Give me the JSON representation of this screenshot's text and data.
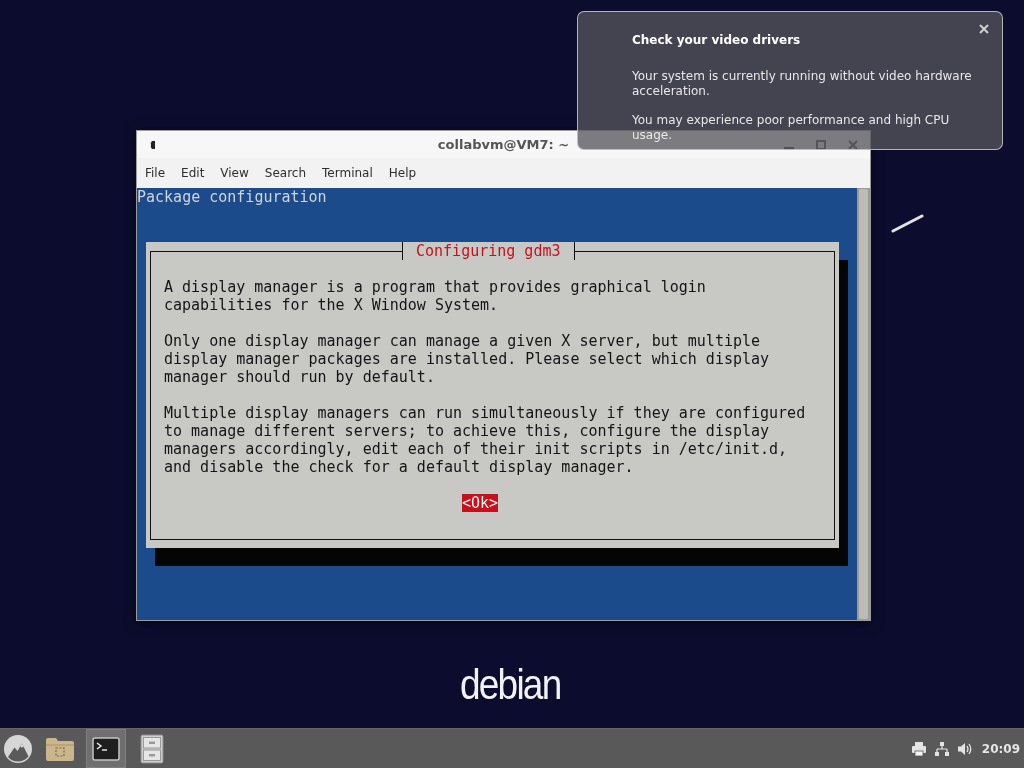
{
  "notification": {
    "title": "Check your video drivers",
    "paragraphs": [
      "Your system is currently running without video hardware acceleration.",
      "You may experience poor performance and high CPU usage."
    ]
  },
  "terminal_window": {
    "title": "collabvm@VM7: ~",
    "menu": [
      "File",
      "Edit",
      "View",
      "Search",
      "Terminal",
      "Help"
    ],
    "screen": {
      "header": "Package configuration",
      "dialog": {
        "title": "Configuring gdm3",
        "paragraphs": [
          "A display manager is a program that provides graphical login capabilities for the X Window System.",
          "Only one display manager can manage a given X server, but multiple display manager packages are installed. Please select which display manager should run by default.",
          "Multiple display managers can run simultaneously if they are configured to manage different servers; to achieve this, configure the display managers accordingly, edit each of their init scripts in /etc/init.d, and disable the check for a default display manager."
        ],
        "button": {
          "label": "<Ok>",
          "focused": true
        }
      }
    }
  },
  "desktop": {
    "logo": "debian"
  },
  "taskbar": {
    "tasks": [
      {
        "kind": "folder",
        "active": false
      },
      {
        "kind": "terminal",
        "active": true
      },
      {
        "kind": "cabinet",
        "active": false
      }
    ],
    "tray": [
      {
        "kind": "printer"
      },
      {
        "kind": "network"
      },
      {
        "kind": "volume"
      }
    ],
    "clock": "20:09"
  }
}
